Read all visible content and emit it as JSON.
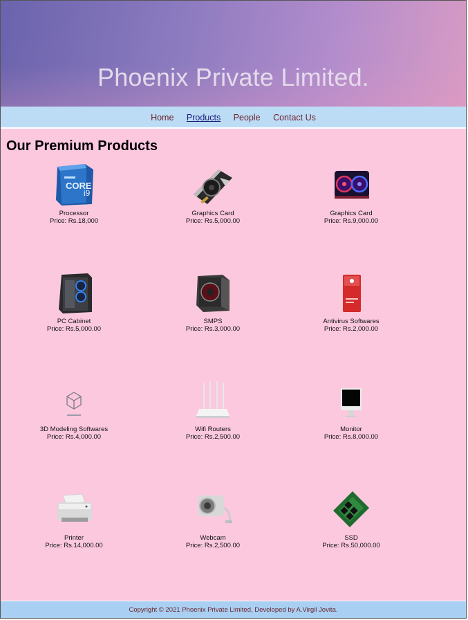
{
  "header": {
    "title": "Phoenix Private Limited."
  },
  "nav": {
    "items": [
      "Home",
      "Products",
      "People",
      "Contact Us"
    ],
    "active": "Products"
  },
  "section": {
    "title": "Our Premium Products"
  },
  "products": [
    {
      "name": "Processor",
      "price": "Price: Rs.18,000",
      "icon": "processor-image"
    },
    {
      "name": "Graphics Card",
      "price": "Price: Rs.5,000.00",
      "icon": "graphics-card-image"
    },
    {
      "name": "Graphics Card",
      "price": "Price: Rs.9,000.00",
      "icon": "graphics-card-rgb-image"
    },
    {
      "name": "PC Cabinet",
      "price": "Price: Rs.5,000.00",
      "icon": "pc-cabinet-image"
    },
    {
      "name": "SMPS",
      "price": "Price: Rs.3,000.00",
      "icon": "smps-image"
    },
    {
      "name": "Antivirus Softwares",
      "price": "Price: Rs.2,000.00",
      "icon": "antivirus-image"
    },
    {
      "name": "3D Modeling Softwares",
      "price": "Price: Rs.4,000.00",
      "icon": "3d-modeling-image"
    },
    {
      "name": "Wifi Routers",
      "price": "Price: Rs.2,500.00",
      "icon": "wifi-router-image"
    },
    {
      "name": "Monitor",
      "price": "Price: Rs.8,000.00",
      "icon": "monitor-image"
    },
    {
      "name": "Printer",
      "price": "Price: Rs.14,000.00",
      "icon": "printer-image"
    },
    {
      "name": "Webcam",
      "price": "Price: Rs.2,500.00",
      "icon": "webcam-image"
    },
    {
      "name": "SSD",
      "price": "Price: Rs.50,000.00",
      "icon": "ssd-image"
    }
  ],
  "footer": {
    "text": "Copyright © 2021 Phoenix Private Limited, Developed by A.Virgil Jovita."
  },
  "colors": {
    "background": "#fcc8de",
    "nav": "#bcdcf6",
    "footer": "#a9d0f2",
    "link": "#6b1f28"
  }
}
